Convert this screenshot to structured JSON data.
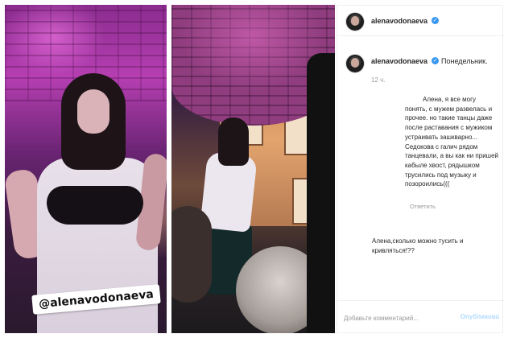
{
  "photo_left": {
    "tag_text": "@alenavodonaeva"
  },
  "post": {
    "header_username": "alenavodonaeva",
    "caption_username": "alenavodonaeva",
    "caption_text": "Понедельник.",
    "time": "12 ч.",
    "comments": [
      {
        "lines": [
          "Алена, я все могу",
          "понять, с мужем развелась и",
          "прочее. но такие танцы даже",
          "после раставания с мужиком",
          "устраивать зашкварно...",
          "Седокова с галич рядом",
          "танцевали, а вы как ни пришей",
          "кабыле хвост, рядышком",
          "трусились под музыку и",
          "позороились((("
        ],
        "reply_label": "Ответить"
      },
      {
        "lines": [
          "Алена,сколько можно тусить и",
          "кривляться!??"
        ]
      }
    ],
    "add_comment_placeholder": "Добавьте комментарий...",
    "publish_label": "Опубликова"
  },
  "colors": {
    "verified_badge": "#3897f0",
    "publish_disabled": "#b3dbff",
    "meta_text": "#999999"
  },
  "icons": {
    "verified": "check-circle",
    "avatar": "profile-photo"
  }
}
